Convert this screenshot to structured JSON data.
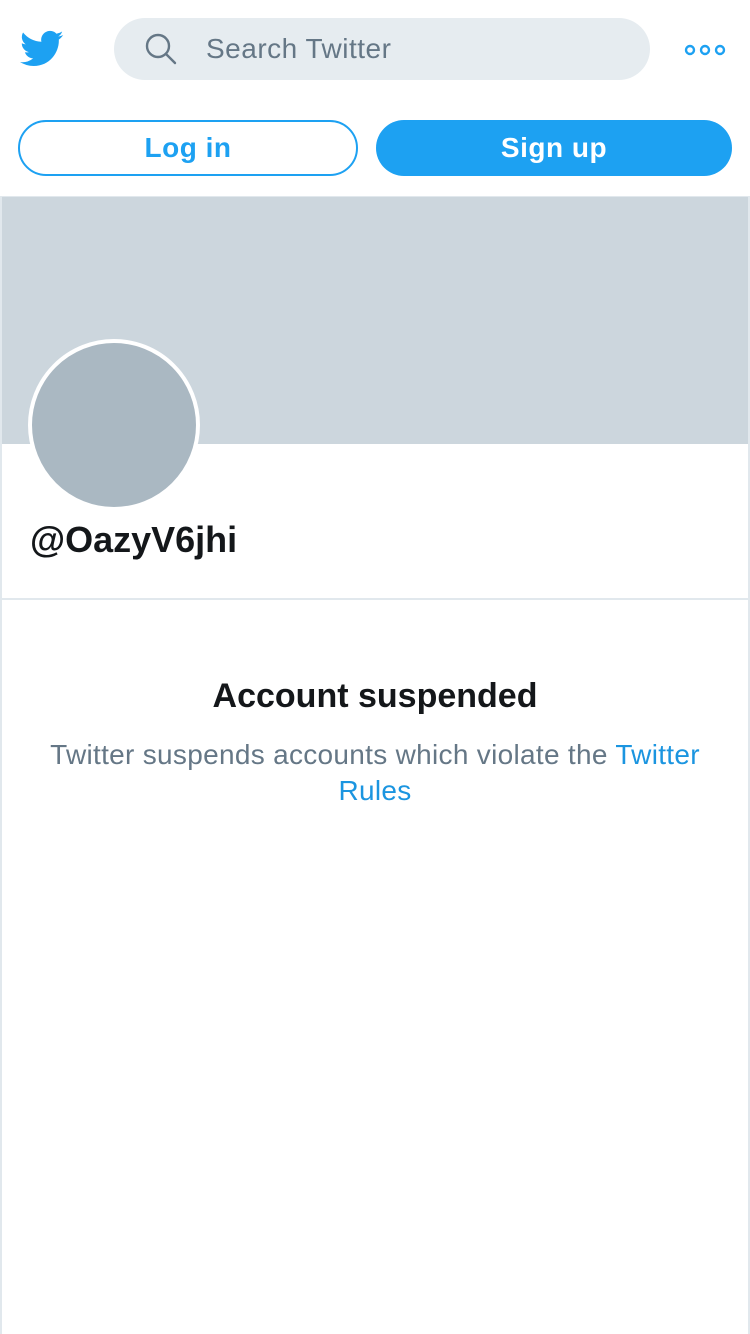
{
  "header": {
    "logo_icon": "twitter-bird-icon",
    "search": {
      "placeholder": "Search Twitter",
      "value": "",
      "icon": "search-icon"
    },
    "more_icon": "more-dots-icon"
  },
  "auth": {
    "login_label": "Log in",
    "signup_label": "Sign up"
  },
  "profile": {
    "handle": "@OazyV6jhi"
  },
  "suspension": {
    "title": "Account suspended",
    "message": "Twitter suspends accounts which violate the",
    "link_text": "Twitter Rules"
  },
  "colors": {
    "brand": "#1da1f2",
    "link": "#1b95e0",
    "banner": "#ccd6dd",
    "avatar": "#aab8c2",
    "muted_text": "#657786",
    "search_bg": "#e6ecf0"
  }
}
